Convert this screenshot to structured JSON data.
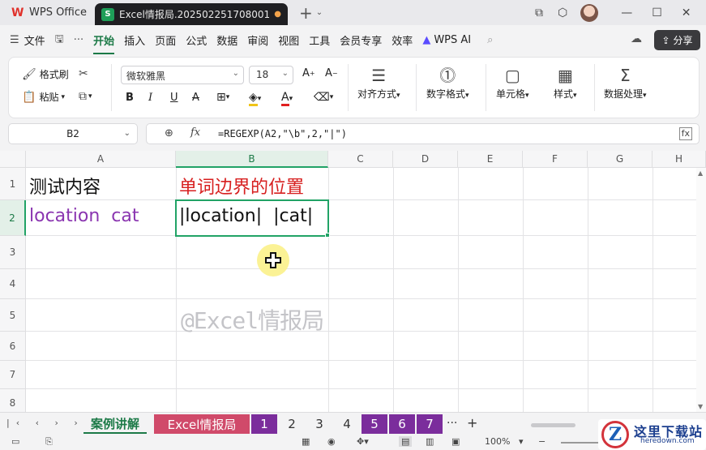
{
  "titlebar": {
    "app_name": "WPS Office",
    "doc_tab_title": "Excel情报局.202502251708001",
    "doc_icon_letter": "S",
    "new_tab": "+",
    "dropdown": "⌄"
  },
  "menu": {
    "file": "文件",
    "items": [
      "开始",
      "插入",
      "页面",
      "公式",
      "数据",
      "审阅",
      "视图",
      "工具",
      "会员专享",
      "效率"
    ],
    "active": "开始",
    "wps_ai": "WPS AI",
    "share": "分享"
  },
  "ribbon": {
    "format_painter": "格式刷",
    "paste": "粘贴",
    "font_name": "微软雅黑",
    "font_size": "18",
    "align": "对齐方式",
    "number_format": "数字格式",
    "cells": "单元格",
    "styles": "样式",
    "data_processing": "数据处理"
  },
  "formula_bar": {
    "cell_ref": "B2",
    "fx": "fx",
    "formula": "=REGEXP(A2,\"\\b\",2,\"|\")"
  },
  "grid": {
    "columns": [
      "A",
      "B",
      "C",
      "D",
      "E",
      "F",
      "G",
      "H"
    ],
    "selected_column": "B",
    "rows": [
      "1",
      "2",
      "3",
      "4",
      "5",
      "6",
      "7",
      "8"
    ],
    "selected_row": "2",
    "cells": {
      "A1": "测试内容",
      "B1": "单词边界的位置",
      "A2": "location  cat",
      "B2": "|location|  |cat|"
    },
    "watermark": "@Excel情报局"
  },
  "sheets": {
    "tabs": [
      {
        "label": "案例讲解",
        "active": true,
        "bg": "#f3f3f4",
        "fg": "#1c7a47"
      },
      {
        "label": "Excel情报局",
        "active": false,
        "bg": "#d04a6a",
        "fg": "#ffffff"
      },
      {
        "label": "1",
        "active": false,
        "bg": "#7b2d9c",
        "fg": "#ffffff"
      },
      {
        "label": "2",
        "active": false,
        "bg": "#f3f3f4",
        "fg": "#333333"
      },
      {
        "label": "3",
        "active": false,
        "bg": "#f3f3f4",
        "fg": "#333333"
      },
      {
        "label": "4",
        "active": false,
        "bg": "#f3f3f4",
        "fg": "#333333"
      },
      {
        "label": "5",
        "active": false,
        "bg": "#7b2d9c",
        "fg": "#ffffff"
      },
      {
        "label": "6",
        "active": false,
        "bg": "#7b2d9c",
        "fg": "#ffffff"
      },
      {
        "label": "7",
        "active": false,
        "bg": "#7b2d9c",
        "fg": "#ffffff"
      }
    ],
    "more": "···",
    "add": "+"
  },
  "statusbar": {
    "zoom": "100%"
  },
  "colors": {
    "accent_green": "#1c7a47",
    "selection_green": "#21a366",
    "header_red": "#d71f1f",
    "value_purple": "#8a35b0"
  },
  "watermark_site": {
    "letter": "Z",
    "cn": "这里下载站",
    "en": "heredown.com"
  }
}
